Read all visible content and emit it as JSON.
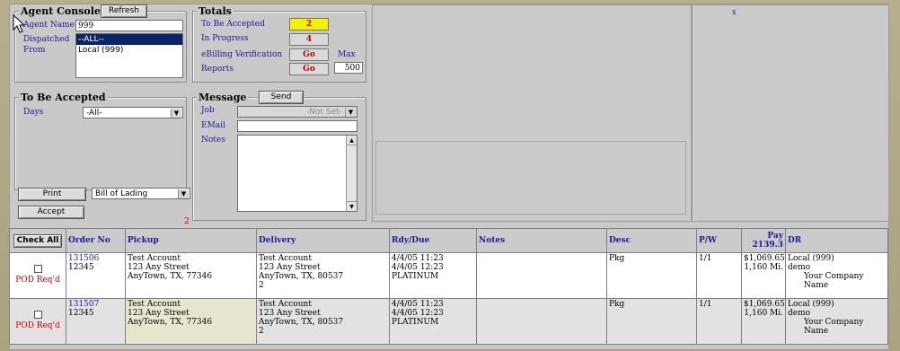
{
  "agent_console": {
    "title": "Agent Console",
    "refresh_label": "Refresh",
    "agent_name_label": "Agent Name",
    "agent_name_value": "999",
    "dispatched_from_label": "Dispatched From",
    "options": [
      "--ALL--",
      "Local (999)"
    ],
    "selected_option": "--ALL--"
  },
  "totals": {
    "title": "Totals",
    "rows": [
      {
        "label": "To Be Accepted",
        "value": "2"
      },
      {
        "label": "In Progress",
        "value": "4"
      },
      {
        "label": "eBilling Verification",
        "value": "Go"
      },
      {
        "label": "Reports",
        "value": "Go"
      }
    ],
    "max_label": "Max",
    "max_value": "500"
  },
  "to_be_accepted": {
    "title": "To Be Accepted",
    "days_label": "Days",
    "days_value": "-All-",
    "print_label": "Print",
    "doc_type": "Bill of Lading",
    "accept_label": "Accept",
    "count_marker": "2"
  },
  "message": {
    "title": "Message",
    "send_label": "Send",
    "job_label": "Job",
    "job_value": "-Not Set-",
    "email_label": "EMail",
    "notes_label": "Notes"
  },
  "marker_x": "x",
  "table": {
    "check_all_label": "Check All",
    "headers": [
      "Order No",
      "Pickup",
      "Delivery",
      "Rdy/Due",
      "Notes",
      "Desc",
      "P/W",
      "Pay",
      "DR"
    ],
    "pay_total": "2139.3",
    "rows": [
      {
        "checkbox_label": "POD Req'd",
        "order_no": "131506",
        "order_ref": "12345",
        "pickup_1": "Test Account",
        "pickup_2": "123 Any Street",
        "pickup_3": "AnyTown, TX, 77346",
        "delivery_1": "Test Account",
        "delivery_2": "123 Any Street",
        "delivery_3": "AnyTown, TX, 80537",
        "delivery_4": "2",
        "ready": "4/4/05 11:23",
        "due": "4/4/05 12:23",
        "service": "PLATINUM",
        "notes": "",
        "desc": "Pkg",
        "pw": "1/1",
        "pay": "$1,069.65",
        "miles": "1,160 Mi.",
        "dr_1": "Local (999)",
        "dr_2": "demo",
        "dr_3": "Your Company Name"
      },
      {
        "checkbox_label": "POD Req'd",
        "order_no": "131507",
        "order_ref": "12345",
        "pickup_1": "Test Account",
        "pickup_2": "123 Any Street",
        "pickup_3": "AnyTown, TX, 77346",
        "delivery_1": "Test Account",
        "delivery_2": "123 Any Street",
        "delivery_3": "AnyTown, TX, 80537",
        "delivery_4": "2",
        "ready": "4/4/05 11:23",
        "due": "4/4/05 12:23",
        "service": "PLATINUM",
        "notes": "",
        "desc": "Pkg",
        "pw": "1/1",
        "pay": "$1,069.65",
        "miles": "1,160 Mi.",
        "dr_1": "Local (999)",
        "dr_2": "demo",
        "dr_3": "Your Company Name"
      }
    ]
  }
}
